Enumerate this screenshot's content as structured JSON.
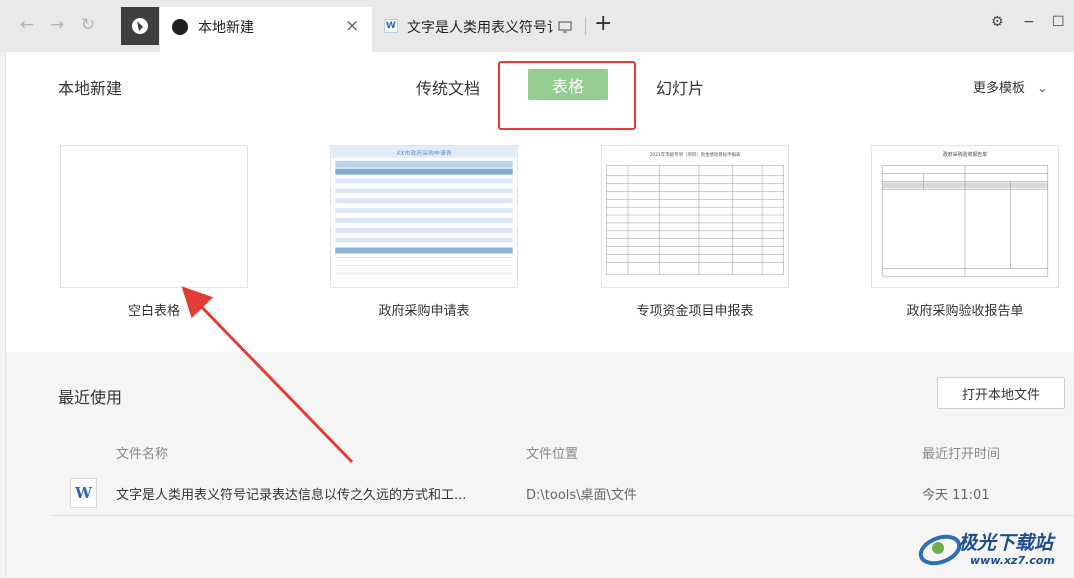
{
  "titlebar": {
    "tabs": [
      {
        "label": "本地新建"
      },
      {
        "label": "文字是人类用表义符号记录表达信息以传之久远的方式和工具"
      }
    ],
    "close_glyph": "×",
    "plus_glyph": "+",
    "back_glyph": "←",
    "forward_glyph": "→",
    "refresh_glyph": "↻",
    "settings_glyph": "⚙",
    "minimize_glyph": "−",
    "maximize_glyph": "☐"
  },
  "header": {
    "title": "本地新建",
    "categories": [
      {
        "label": "传统文档"
      },
      {
        "label": "表格"
      },
      {
        "label": "幻灯片"
      }
    ],
    "more_templates": "更多模板",
    "chevron": "⌄"
  },
  "templates": [
    {
      "label": "空白表格",
      "thumb_title": ""
    },
    {
      "label": "政府采购申请表",
      "thumb_title": "XX市政府采购申请表"
    },
    {
      "label": "专项资金项目申报表",
      "thumb_title": "2021年市级专项（项目）资金绩效目标申报表"
    },
    {
      "label": "政府采购验收报告单",
      "thumb_title": "政府采购验收报告单"
    }
  ],
  "recent": {
    "title": "最近使用",
    "open_local_button": "打开本地文件",
    "columns": [
      "文件名称",
      "文件位置",
      "最近打开时间"
    ],
    "rows": [
      {
        "icon": "W",
        "name": "文字是人类用表义符号记录表达信息以传之久远的方式和工...",
        "location": "D:\\tools\\桌面\\文件",
        "time": "今天 11:01"
      }
    ]
  },
  "watermark": {
    "text": "极光下载站",
    "url": "www.xz7.com"
  },
  "colors": {
    "accent_green": "#94cd8f",
    "annotation_red": "#e53b35",
    "tabbar": "#e9e9ea"
  }
}
